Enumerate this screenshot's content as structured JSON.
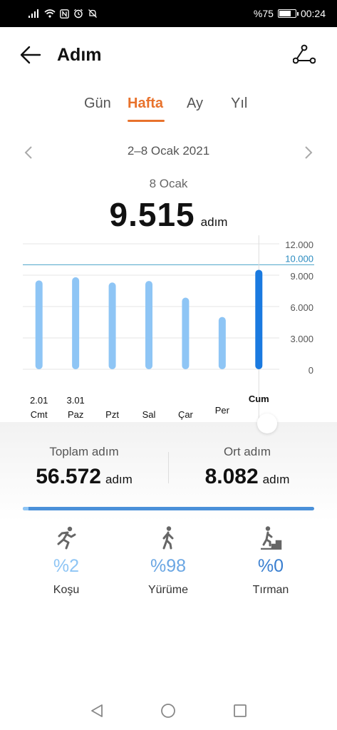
{
  "status_bar": {
    "battery": "%75",
    "battery_level": 0.75,
    "time": "00:24"
  },
  "header": {
    "title": "Adım"
  },
  "tabs": [
    {
      "label": "Gün",
      "active": false
    },
    {
      "label": "Hafta",
      "active": true
    },
    {
      "label": "Ay",
      "active": false
    },
    {
      "label": "Yıl",
      "active": false
    }
  ],
  "date_range": "2–8 Ocak 2021",
  "selected": {
    "day": "8 Ocak",
    "value": "9.515",
    "unit": "adım"
  },
  "chart_data": {
    "type": "bar",
    "categories": [
      {
        "date": "2.01",
        "day": "Cmt"
      },
      {
        "date": "3.01",
        "day": "Paz"
      },
      {
        "date": "",
        "day": "Pzt"
      },
      {
        "date": "",
        "day": "Sal"
      },
      {
        "date": "",
        "day": "Çar"
      },
      {
        "date": "",
        "day": "Per"
      },
      {
        "date": "",
        "day": "Cum"
      }
    ],
    "values": [
      8500,
      8800,
      8300,
      8450,
      6850,
      5000,
      9515
    ],
    "selected_index": 6,
    "y_ticks": [
      "12.000",
      "9.000",
      "6.000",
      "3.000",
      "0"
    ],
    "y_tick_values": [
      12000,
      9000,
      6000,
      3000,
      0
    ],
    "ylim": [
      0,
      12000
    ],
    "goal": {
      "label": "10.000",
      "value": 10000
    },
    "colors": {
      "bar": "#8ec5f5",
      "bar_selected": "#1a7ae0",
      "goal": "#4aa3c8"
    }
  },
  "summary": {
    "total": {
      "label": "Toplam adım",
      "value": "56.572",
      "unit": "adım"
    },
    "average": {
      "label": "Ort adım",
      "value": "8.082",
      "unit": "adım"
    }
  },
  "activities": [
    {
      "icon": "running-icon",
      "percent": "%2",
      "label": "Koşu",
      "color": "#8ec5f5"
    },
    {
      "icon": "walking-icon",
      "percent": "%98",
      "label": "Yürüme",
      "color": "#6aa6e3"
    },
    {
      "icon": "climbing-icon",
      "percent": "%0",
      "label": "Tırman",
      "color": "#3a7fd0"
    }
  ],
  "progress": {
    "running_fraction": 0.02
  }
}
